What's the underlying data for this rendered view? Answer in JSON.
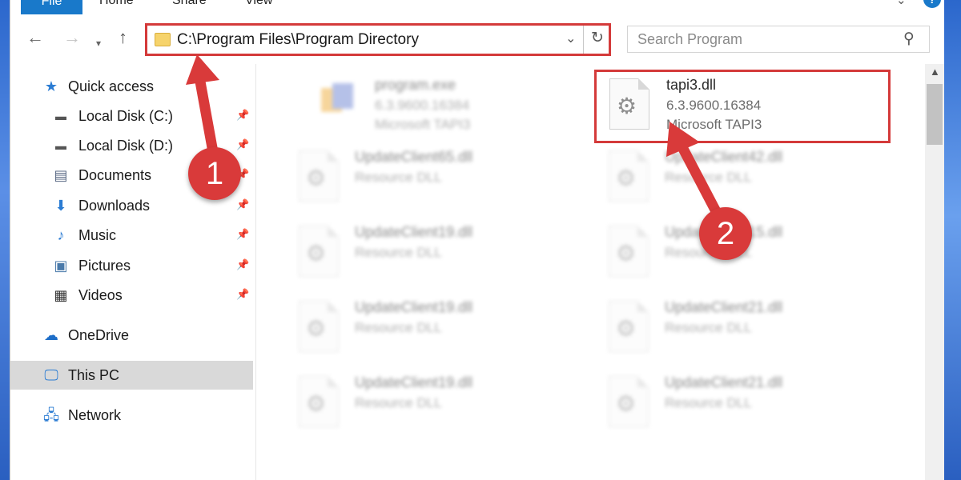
{
  "ribbon": {
    "tabs": [
      "File",
      "Home",
      "Share",
      "View"
    ],
    "help_label": "?"
  },
  "address_bar": {
    "path": "C:\\Program Files\\Program Directory"
  },
  "search": {
    "placeholder": "Search Program"
  },
  "sidebar": {
    "items": [
      {
        "label": "Quick access",
        "icon": "star-icon"
      },
      {
        "label": "Local Disk (C:)",
        "icon": "drive-icon",
        "pinned": true
      },
      {
        "label": "Local Disk (D:)",
        "icon": "drive-icon",
        "pinned": true
      },
      {
        "label": "Documents",
        "icon": "document-icon",
        "pinned": true
      },
      {
        "label": "Downloads",
        "icon": "download-icon",
        "pinned": true
      },
      {
        "label": "Music",
        "icon": "music-icon",
        "pinned": true
      },
      {
        "label": "Pictures",
        "icon": "pictures-icon",
        "pinned": true
      },
      {
        "label": "Videos",
        "icon": "videos-icon",
        "pinned": true
      },
      {
        "label": "OneDrive",
        "icon": "cloud-icon"
      },
      {
        "label": "This PC",
        "icon": "computer-icon",
        "selected": true
      },
      {
        "label": "Network",
        "icon": "network-icon"
      }
    ]
  },
  "files": [
    {
      "name": "program.exe",
      "line1": "6.3.9600.16384",
      "line2": "Microsoft TAPI3",
      "blurred": true
    },
    {
      "name": "tapi3.dll",
      "line1": "6.3.9600.16384",
      "line2": "Microsoft TAPI3",
      "blurred": false
    },
    {
      "name": "UpdateClient65.dll",
      "line1": "Resource DLL",
      "blurred": true
    },
    {
      "name": "UpdateClient42.dll",
      "line1": "Resource DLL",
      "blurred": true
    },
    {
      "name": "UpdateClient19.dll",
      "line1": "Resource DLL",
      "blurred": true
    },
    {
      "name": "UpdateClient15.dll",
      "line1": "Resource DLL",
      "blurred": true
    },
    {
      "name": "UpdateClient19.dll",
      "line1": "Resource DLL",
      "blurred": true
    },
    {
      "name": "UpdateClient21.dll",
      "line1": "Resource DLL",
      "blurred": true
    },
    {
      "name": "UpdateClient19.dll",
      "line1": "Resource DLL",
      "blurred": true
    },
    {
      "name": "UpdateClient21.dll",
      "line1": "Resource DLL",
      "blurred": true
    }
  ],
  "annotations": {
    "step1": "1",
    "step2": "2",
    "color": "#d93a3a"
  }
}
